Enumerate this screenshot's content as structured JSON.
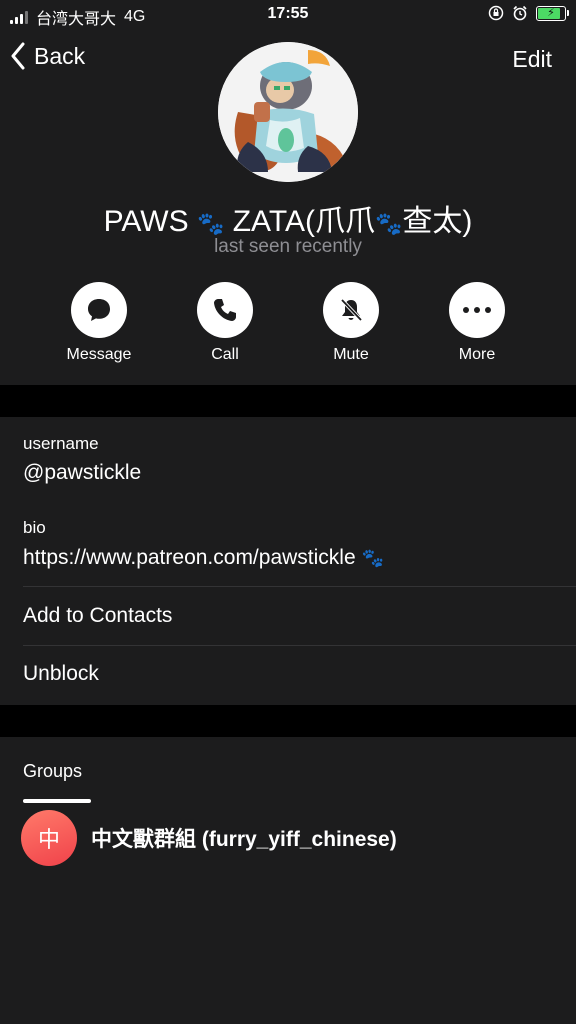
{
  "status_bar": {
    "carrier": "台湾大哥大",
    "network": "4G",
    "time": "17:55",
    "battery_color": "#4cd964"
  },
  "nav": {
    "back_label": "Back",
    "edit_label": "Edit"
  },
  "profile": {
    "name_part1": "PAWS",
    "name_part2": "ZATA(爪爪",
    "name_part3": "查太)",
    "paw_glyph": "🐾",
    "last_seen": "last seen recently"
  },
  "actions": [
    {
      "label": "Message",
      "icon": "message-icon"
    },
    {
      "label": "Call",
      "icon": "phone-icon"
    },
    {
      "label": "Mute",
      "icon": "bell-slash-icon"
    },
    {
      "label": "More",
      "icon": "ellipsis-icon"
    }
  ],
  "info": {
    "username_label": "username",
    "username_value": "@pawstickle",
    "bio_label": "bio",
    "bio_value": "https://www.patreon.com/pawstickle",
    "add_contacts": "Add to Contacts",
    "unblock": "Unblock"
  },
  "groups": {
    "title": "Groups",
    "items": [
      {
        "initial": "中",
        "name": "中文獸群組 (furry_yiff_chinese)"
      }
    ]
  }
}
